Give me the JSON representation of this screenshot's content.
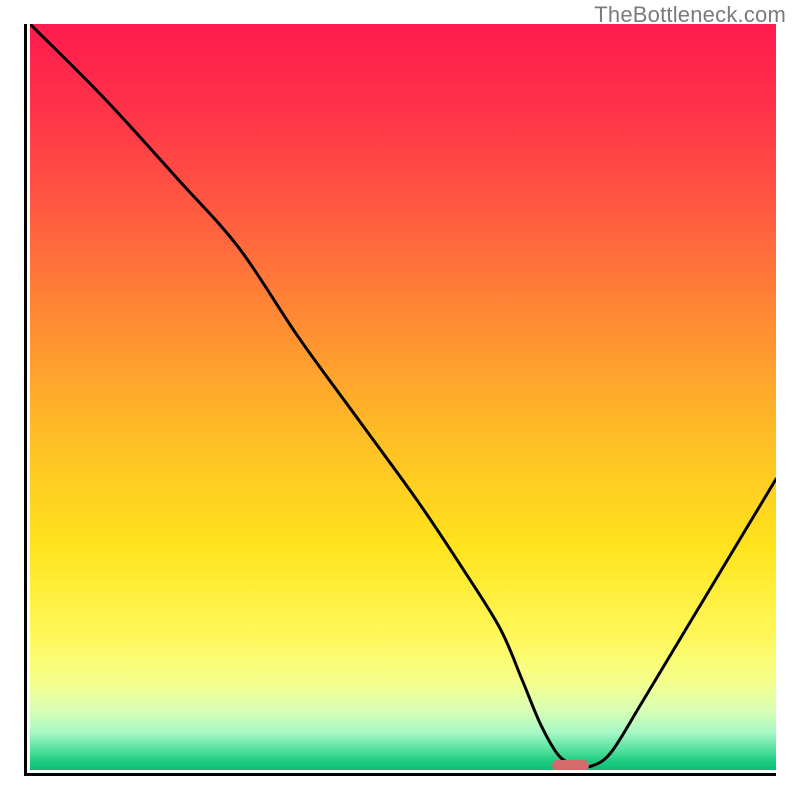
{
  "watermark": "TheBottleneck.com",
  "chart_data": {
    "type": "line",
    "title": "",
    "xlabel": "",
    "ylabel": "",
    "xlim": [
      0,
      100
    ],
    "ylim": [
      0,
      100
    ],
    "grid": false,
    "series": [
      {
        "name": "bottleneck-curve",
        "color": "#000000",
        "x": [
          0,
          10,
          20,
          28,
          36,
          44,
          52,
          58,
          63,
          66,
          68.5,
          71,
          73.5,
          75.5,
          78,
          82,
          88,
          94,
          100
        ],
        "y": [
          100,
          90,
          79,
          70,
          58,
          47,
          36,
          27,
          19,
          12,
          6,
          1.8,
          0.6,
          0.6,
          2.5,
          9,
          19,
          29,
          39
        ]
      }
    ],
    "marker": {
      "name": "optimal-point",
      "x_center": 72.5,
      "y_center": 0.6,
      "width": 5,
      "height": 1.4,
      "color": "#d46a6a"
    },
    "gradient_legend_note": "Background encodes bottleneck severity: top=red (high), bottom=green (none)."
  }
}
